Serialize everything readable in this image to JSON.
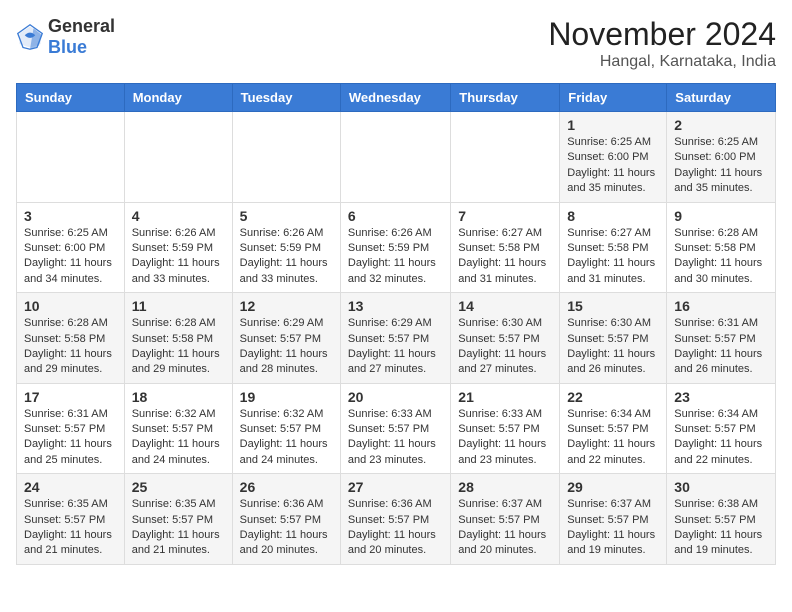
{
  "logo": {
    "general": "General",
    "blue": "Blue"
  },
  "header": {
    "month": "November 2024",
    "location": "Hangal, Karnataka, India"
  },
  "weekdays": [
    "Sunday",
    "Monday",
    "Tuesday",
    "Wednesday",
    "Thursday",
    "Friday",
    "Saturday"
  ],
  "weeks": [
    [
      {
        "day": "",
        "info": ""
      },
      {
        "day": "",
        "info": ""
      },
      {
        "day": "",
        "info": ""
      },
      {
        "day": "",
        "info": ""
      },
      {
        "day": "",
        "info": ""
      },
      {
        "day": "1",
        "info": "Sunrise: 6:25 AM\nSunset: 6:00 PM\nDaylight: 11 hours and 35 minutes."
      },
      {
        "day": "2",
        "info": "Sunrise: 6:25 AM\nSunset: 6:00 PM\nDaylight: 11 hours and 35 minutes."
      }
    ],
    [
      {
        "day": "3",
        "info": "Sunrise: 6:25 AM\nSunset: 6:00 PM\nDaylight: 11 hours and 34 minutes."
      },
      {
        "day": "4",
        "info": "Sunrise: 6:26 AM\nSunset: 5:59 PM\nDaylight: 11 hours and 33 minutes."
      },
      {
        "day": "5",
        "info": "Sunrise: 6:26 AM\nSunset: 5:59 PM\nDaylight: 11 hours and 33 minutes."
      },
      {
        "day": "6",
        "info": "Sunrise: 6:26 AM\nSunset: 5:59 PM\nDaylight: 11 hours and 32 minutes."
      },
      {
        "day": "7",
        "info": "Sunrise: 6:27 AM\nSunset: 5:58 PM\nDaylight: 11 hours and 31 minutes."
      },
      {
        "day": "8",
        "info": "Sunrise: 6:27 AM\nSunset: 5:58 PM\nDaylight: 11 hours and 31 minutes."
      },
      {
        "day": "9",
        "info": "Sunrise: 6:28 AM\nSunset: 5:58 PM\nDaylight: 11 hours and 30 minutes."
      }
    ],
    [
      {
        "day": "10",
        "info": "Sunrise: 6:28 AM\nSunset: 5:58 PM\nDaylight: 11 hours and 29 minutes."
      },
      {
        "day": "11",
        "info": "Sunrise: 6:28 AM\nSunset: 5:58 PM\nDaylight: 11 hours and 29 minutes."
      },
      {
        "day": "12",
        "info": "Sunrise: 6:29 AM\nSunset: 5:57 PM\nDaylight: 11 hours and 28 minutes."
      },
      {
        "day": "13",
        "info": "Sunrise: 6:29 AM\nSunset: 5:57 PM\nDaylight: 11 hours and 27 minutes."
      },
      {
        "day": "14",
        "info": "Sunrise: 6:30 AM\nSunset: 5:57 PM\nDaylight: 11 hours and 27 minutes."
      },
      {
        "day": "15",
        "info": "Sunrise: 6:30 AM\nSunset: 5:57 PM\nDaylight: 11 hours and 26 minutes."
      },
      {
        "day": "16",
        "info": "Sunrise: 6:31 AM\nSunset: 5:57 PM\nDaylight: 11 hours and 26 minutes."
      }
    ],
    [
      {
        "day": "17",
        "info": "Sunrise: 6:31 AM\nSunset: 5:57 PM\nDaylight: 11 hours and 25 minutes."
      },
      {
        "day": "18",
        "info": "Sunrise: 6:32 AM\nSunset: 5:57 PM\nDaylight: 11 hours and 24 minutes."
      },
      {
        "day": "19",
        "info": "Sunrise: 6:32 AM\nSunset: 5:57 PM\nDaylight: 11 hours and 24 minutes."
      },
      {
        "day": "20",
        "info": "Sunrise: 6:33 AM\nSunset: 5:57 PM\nDaylight: 11 hours and 23 minutes."
      },
      {
        "day": "21",
        "info": "Sunrise: 6:33 AM\nSunset: 5:57 PM\nDaylight: 11 hours and 23 minutes."
      },
      {
        "day": "22",
        "info": "Sunrise: 6:34 AM\nSunset: 5:57 PM\nDaylight: 11 hours and 22 minutes."
      },
      {
        "day": "23",
        "info": "Sunrise: 6:34 AM\nSunset: 5:57 PM\nDaylight: 11 hours and 22 minutes."
      }
    ],
    [
      {
        "day": "24",
        "info": "Sunrise: 6:35 AM\nSunset: 5:57 PM\nDaylight: 11 hours and 21 minutes."
      },
      {
        "day": "25",
        "info": "Sunrise: 6:35 AM\nSunset: 5:57 PM\nDaylight: 11 hours and 21 minutes."
      },
      {
        "day": "26",
        "info": "Sunrise: 6:36 AM\nSunset: 5:57 PM\nDaylight: 11 hours and 20 minutes."
      },
      {
        "day": "27",
        "info": "Sunrise: 6:36 AM\nSunset: 5:57 PM\nDaylight: 11 hours and 20 minutes."
      },
      {
        "day": "28",
        "info": "Sunrise: 6:37 AM\nSunset: 5:57 PM\nDaylight: 11 hours and 20 minutes."
      },
      {
        "day": "29",
        "info": "Sunrise: 6:37 AM\nSunset: 5:57 PM\nDaylight: 11 hours and 19 minutes."
      },
      {
        "day": "30",
        "info": "Sunrise: 6:38 AM\nSunset: 5:57 PM\nDaylight: 11 hours and 19 minutes."
      }
    ]
  ]
}
